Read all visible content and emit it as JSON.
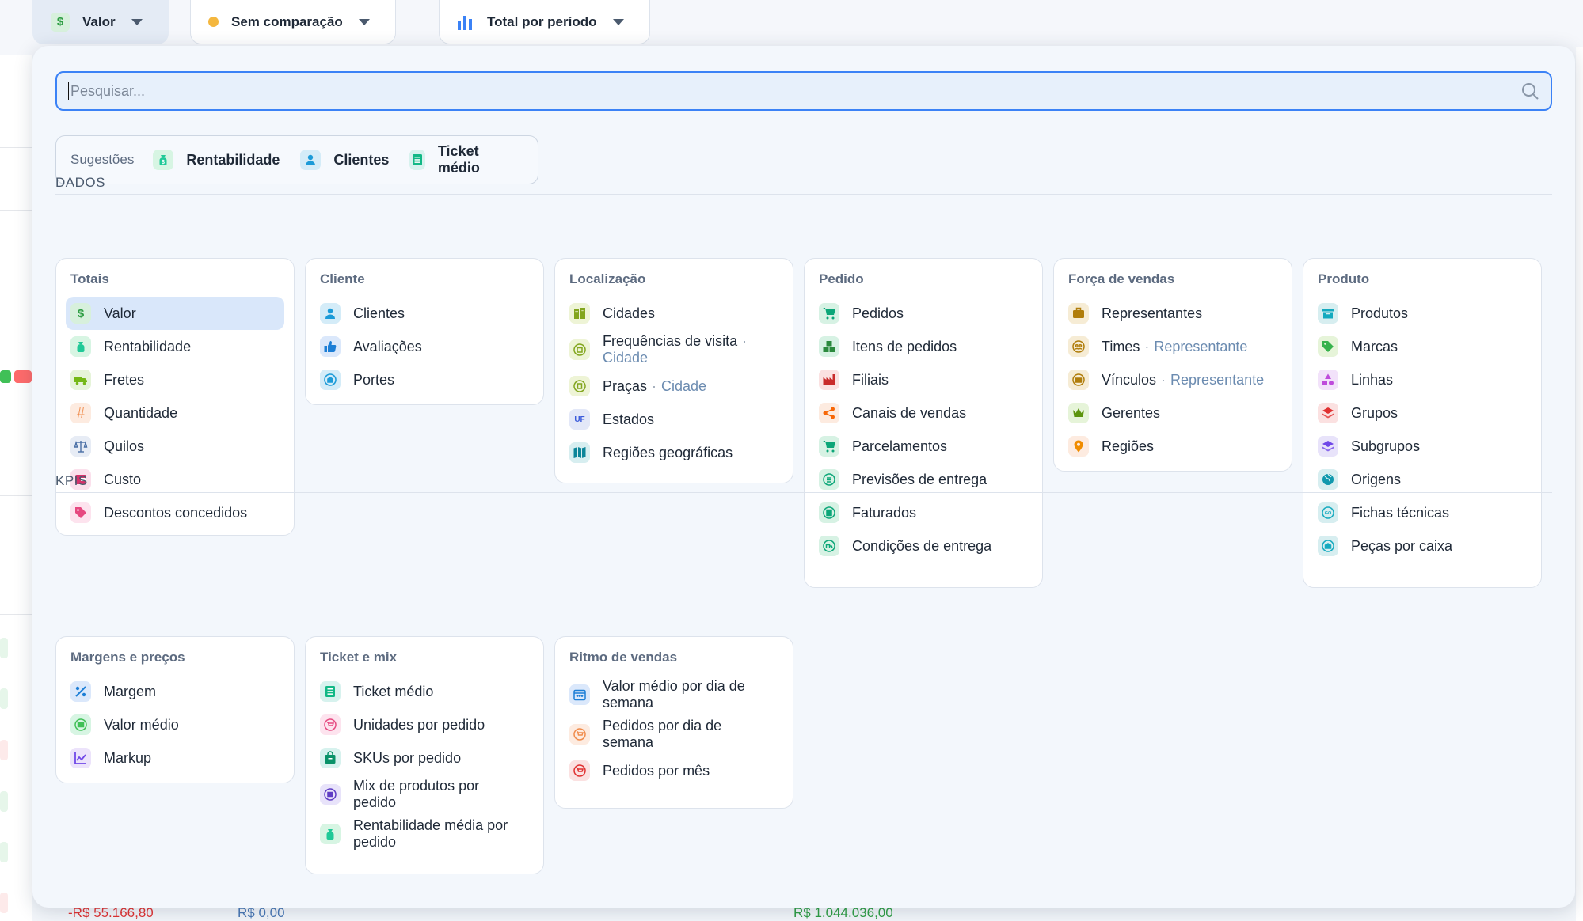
{
  "toolbar": {
    "metric_label": "Valor",
    "compare_label": "Sem comparação",
    "period_label": "Total por período"
  },
  "search": {
    "placeholder": "Pesquisar..."
  },
  "suggestions": {
    "label": "Sugestões",
    "items": [
      "Rentabilidade",
      "Clientes",
      "Ticket médio"
    ]
  },
  "sections": {
    "dados": "DADOS",
    "kpis": "KPIS"
  },
  "dados": {
    "totais": {
      "title": "Totais",
      "items": [
        "Valor",
        "Rentabilidade",
        "Fretes",
        "Quantidade",
        "Quilos",
        "Custo",
        "Descontos concedidos"
      ]
    },
    "cliente": {
      "title": "Cliente",
      "items": [
        "Clientes",
        "Avaliações",
        "Portes"
      ]
    },
    "localizacao": {
      "title": "Localização",
      "items": [
        "Cidades",
        "Frequências de visita",
        "Praças",
        "Estados",
        "Regiões geográficas"
      ],
      "subs": {
        "freq": "Cidade",
        "pracas": "Cidade"
      }
    },
    "pedido": {
      "title": "Pedido",
      "items": [
        "Pedidos",
        "Itens de pedidos",
        "Filiais",
        "Canais de vendas",
        "Parcelamentos",
        "Previsões de entrega",
        "Faturados",
        "Condições de entrega"
      ]
    },
    "forca": {
      "title": "Força de vendas",
      "items": [
        "Representantes",
        "Times",
        "Vínculos",
        "Gerentes",
        "Regiões"
      ],
      "subs": {
        "times": "Representante",
        "vinculos": "Representante"
      }
    },
    "produto": {
      "title": "Produto",
      "items": [
        "Produtos",
        "Marcas",
        "Linhas",
        "Grupos",
        "Subgrupos",
        "Origens",
        "Fichas técnicas",
        "Peças por caixa"
      ]
    }
  },
  "kpis": {
    "margens": {
      "title": "Margens e preços",
      "items": [
        "Margem",
        "Valor médio",
        "Markup"
      ]
    },
    "ticket": {
      "title": "Ticket e mix",
      "items": [
        "Ticket médio",
        "Unidades por pedido",
        "SKUs por pedido",
        "Mix de produtos por pedido",
        "Rentabilidade média por pedido"
      ]
    },
    "ritmo": {
      "title": "Ritmo de vendas",
      "items": [
        "Valor médio por dia de semana",
        "Pedidos por dia de semana",
        "Pedidos por mês"
      ]
    }
  },
  "background": {
    "values": [
      "-R$ 55.166,80",
      "R$ 0,00",
      "R$ 1.044.036,00"
    ]
  },
  "colors": {
    "accent": "#3b82f6",
    "negative": "#e03131",
    "positive": "#2f9e44"
  }
}
